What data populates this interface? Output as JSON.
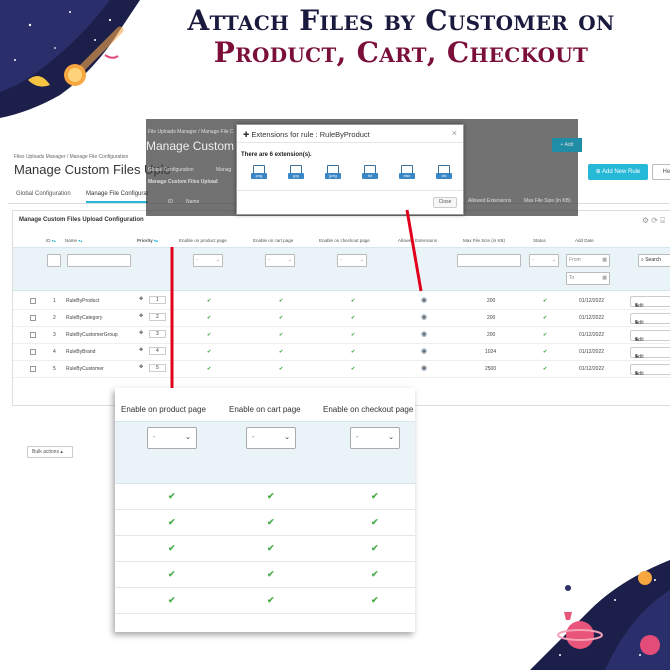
{
  "banner": {
    "line1": "Attach Files by Customer on",
    "line2": "Product, Cart, Checkout"
  },
  "admin": {
    "breadcrumb_root": "Files Uploads Manager",
    "breadcrumb_current": "Manage File Configuration",
    "page_title": "Manage Custom Files Uplo",
    "add_new_rule": "Add New Rule",
    "help": "Hel",
    "tabs": [
      "Global Configuration",
      "Manage File Configurat"
    ],
    "panel_title": "Manage Custom Files Upload Configuration",
    "columns": {
      "id": "ID",
      "name": "Name",
      "priority": "Priority",
      "product": "Enable on product page",
      "cart": "Enable on cart page",
      "checkout": "Enable on checkout page",
      "extensions": "Allowed Extensions",
      "maxsize": "Max File Size (in KB)",
      "status": "Status",
      "date": "Add Date"
    },
    "filter_placeholder": "-",
    "from_placeholder": "From",
    "to_placeholder": "To",
    "search": "Search",
    "edit": "Edit",
    "bulk_actions": "Bulk actions",
    "rows": [
      {
        "id": "1",
        "name": "RuleByProduct",
        "priority": "1",
        "size": "200",
        "date": "01/12/2022"
      },
      {
        "id": "2",
        "name": "RuleByCategory",
        "priority": "2",
        "size": "200",
        "date": "01/12/2022"
      },
      {
        "id": "3",
        "name": "RuleByCustomerGroup",
        "priority": "3",
        "size": "200",
        "date": "01/12/2022"
      },
      {
        "id": "4",
        "name": "RuleByBrand",
        "priority": "4",
        "size": "1024",
        "date": "01/12/2022"
      },
      {
        "id": "5",
        "name": "RuleByCustomer",
        "priority": "5",
        "size": "2500",
        "date": "01/12/2022"
      }
    ]
  },
  "overlay": {
    "crumb": "File Uploads Manager / Manage File C",
    "title": "Manage Custom Fi",
    "tab1": "Global Configuration",
    "tab2": "Manag",
    "sub": "Manage Custom Files Upload",
    "add": "Add",
    "ext_head": "Allowed Extensions",
    "size_head": "Max File Size (in KB)",
    "id_head": "ID",
    "name_head": "Name"
  },
  "modal": {
    "title": "Extensions for rule : RuleByProduct",
    "count": "There are 6 extension(s).",
    "extensions": [
      "png",
      "jpg",
      "jpeg",
      "txt",
      "xlsx",
      "xls"
    ],
    "close": "Close"
  },
  "zoom": {
    "product": "Enable on product page",
    "cart": "Enable on cart page",
    "checkout": "Enable on checkout page",
    "select_value": "-"
  },
  "colors": {
    "accent": "#25b9d7",
    "check": "#4caf50",
    "title_navy": "#1a1a3e",
    "title_maroon": "#7a0f3a",
    "pointer": "#e0001b"
  }
}
